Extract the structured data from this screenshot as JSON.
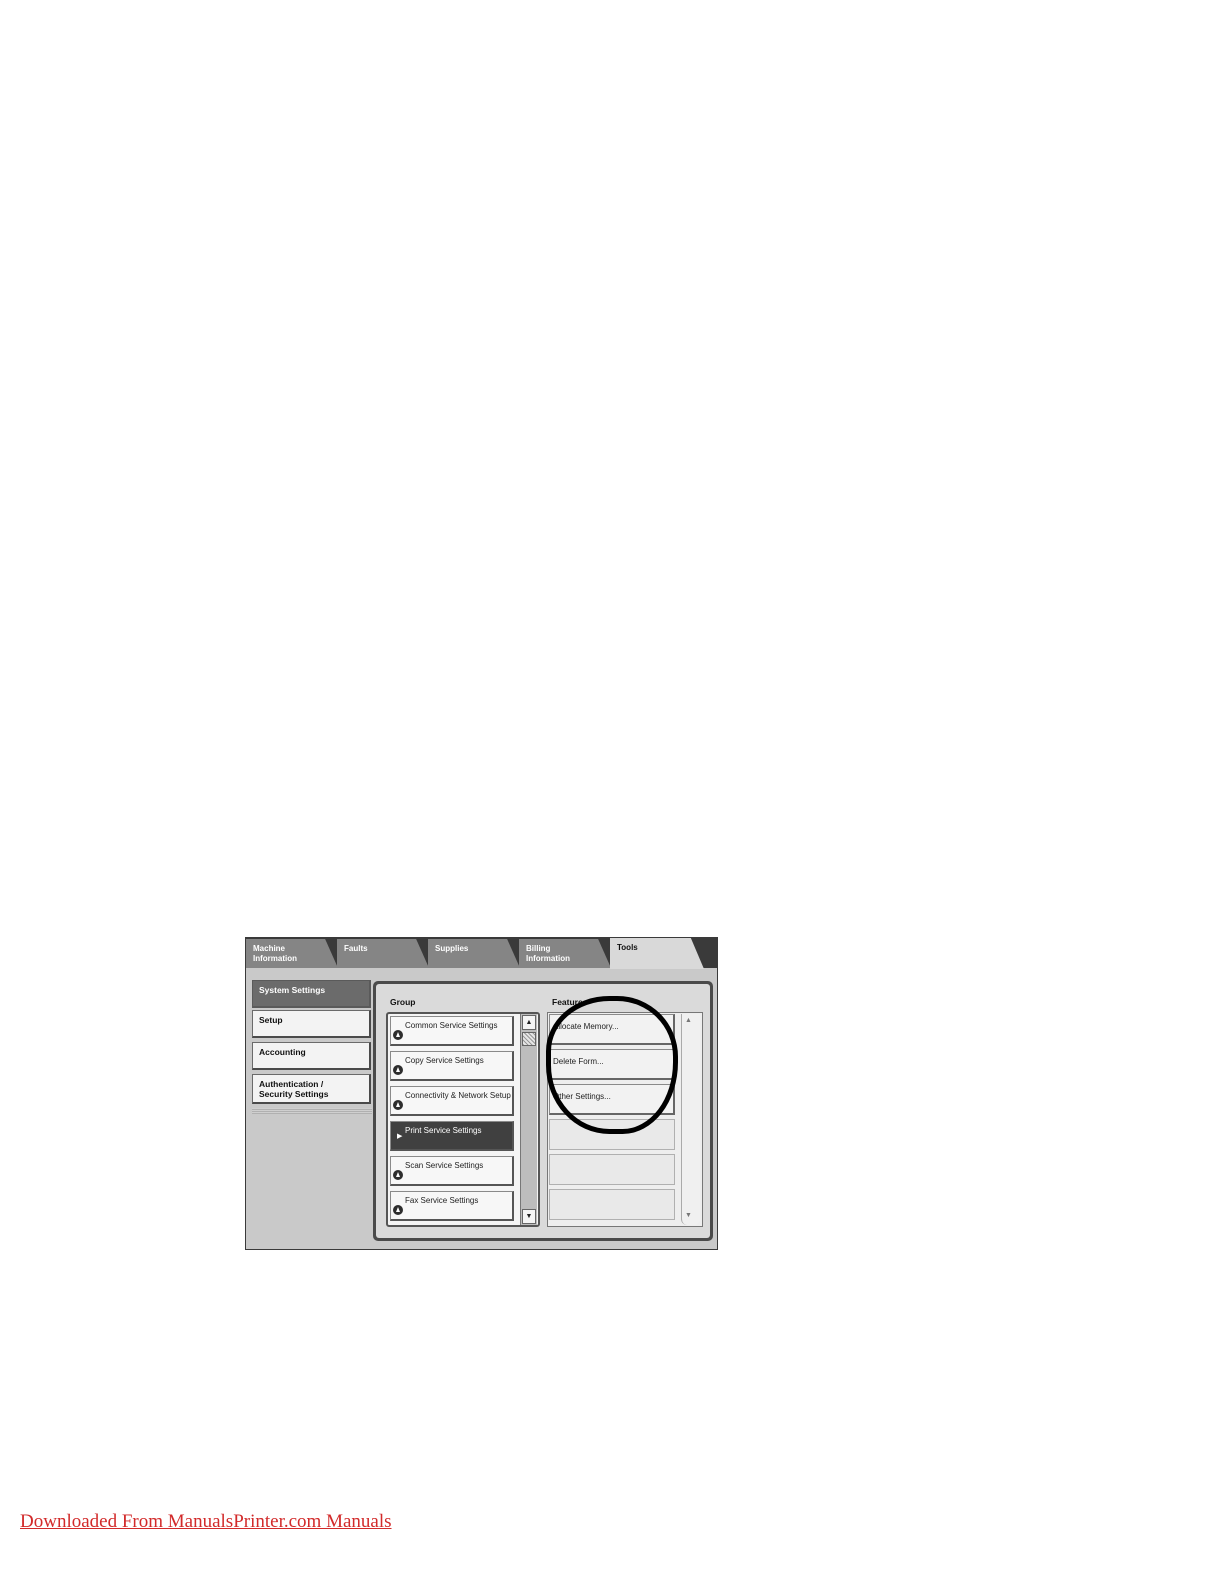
{
  "tabs": [
    {
      "label": "Machine\nInformation",
      "active": false
    },
    {
      "label": "Faults",
      "active": false
    },
    {
      "label": "Supplies",
      "active": false
    },
    {
      "label": "Billing\nInformation",
      "active": false
    },
    {
      "label": "Tools",
      "active": true
    }
  ],
  "sidebar": {
    "items": [
      {
        "label": "System Settings",
        "selected": true
      },
      {
        "label": "Setup",
        "selected": false
      },
      {
        "label": "Accounting",
        "selected": false
      },
      {
        "label": "Authentication /\nSecurity Settings",
        "selected": false
      }
    ]
  },
  "main": {
    "group_label": "Group",
    "features_label": "Features",
    "groups": [
      {
        "label": "Common Service Settings",
        "selected": false,
        "icon": "expand-circle-icon"
      },
      {
        "label": "Copy Service Settings",
        "selected": false,
        "icon": "expand-circle-icon"
      },
      {
        "label": "Connectivity & Network Setup",
        "selected": false,
        "icon": "expand-circle-icon"
      },
      {
        "label": "Print Service Settings",
        "selected": true,
        "icon": "arrow-right-icon"
      },
      {
        "label": "Scan Service Settings",
        "selected": false,
        "icon": "expand-circle-icon"
      },
      {
        "label": "Fax Service Settings",
        "selected": false,
        "icon": "expand-circle-icon"
      }
    ],
    "features": [
      {
        "label": "Allocate Memory..."
      },
      {
        "label": "Delete Form..."
      },
      {
        "label": "Other Settings..."
      }
    ],
    "scroll_up": "▲",
    "scroll_down": "▼"
  },
  "footer": {
    "link_text": "Downloaded From ManualsPrinter.com Manuals",
    "color": "#d22a2a"
  }
}
